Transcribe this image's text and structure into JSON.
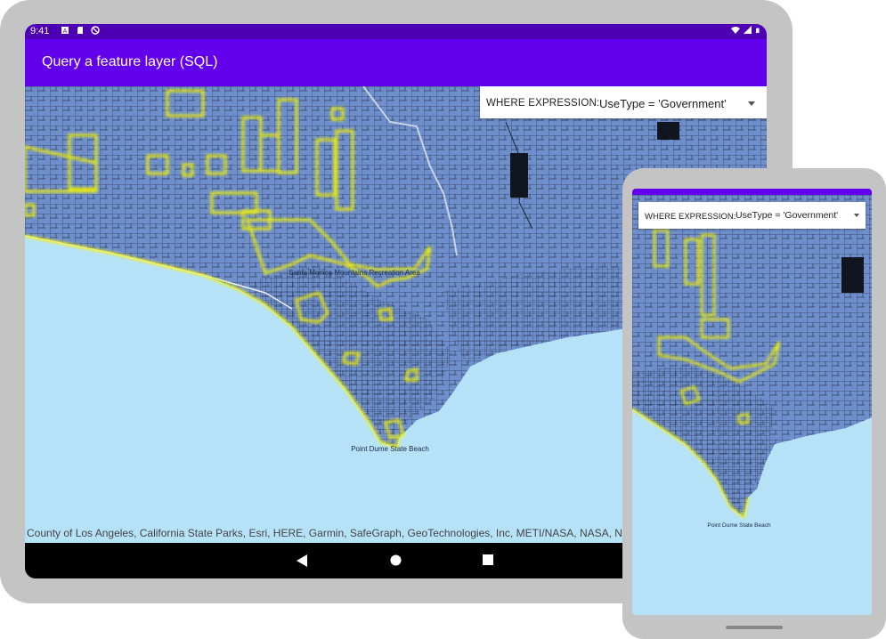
{
  "status_bar": {
    "time": "9:41"
  },
  "app_bar": {
    "title": "Query a feature layer (SQL)"
  },
  "query": {
    "label": "WHERE EXPRESSION:",
    "value": "UseType = 'Government'"
  },
  "map": {
    "labels": [
      "Santa Monica Mountains Recreation Area",
      "Point Dume State Beach"
    ],
    "attribution": "County of Los Angeles, California State Parks, Esri, HERE, Garmin, SafeGraph, GeoTechnologies, Inc, METI/NASA, NASA, NGA,"
  },
  "phone": {
    "query_label": "WHERE EXPRESSION:",
    "query_value": "UseType = 'Government'"
  },
  "colors": {
    "primary": "#6200ee",
    "status_bar": "#4d00b3",
    "land": "#6f8fcc",
    "ocean": "#b6e2f8",
    "highlight": "#f4f400"
  }
}
